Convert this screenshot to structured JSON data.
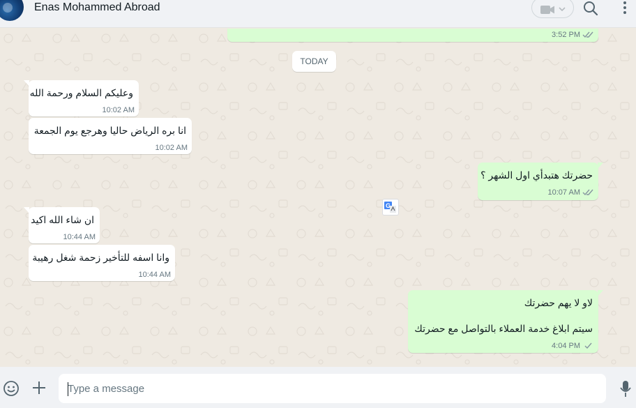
{
  "contact": {
    "name": "Enas Mohammed Abroad"
  },
  "header": {
    "icons": [
      "video-call-icon",
      "chevron-down-icon",
      "search-icon",
      "menu-icon"
    ]
  },
  "day_divider": "TODAY",
  "messages": [
    {
      "direction": "out",
      "text": "",
      "time": "3:52 PM",
      "status": "read"
    },
    {
      "direction": "in",
      "text": "وعليكم السلام ورحمة الله",
      "time": "10:02 AM"
    },
    {
      "direction": "in",
      "text": "انا بره الرياض حاليا وهرجع يوم الجمعة",
      "time": "10:02 AM"
    },
    {
      "direction": "out",
      "text": "حضرتك هتبدأي اول الشهر ؟",
      "time": "10:07 AM",
      "status": "read"
    },
    {
      "direction": "in",
      "text": "ان شاء الله اكيد",
      "time": "10:44 AM"
    },
    {
      "direction": "in",
      "text": "وانا اسفه للتأخير زحمة شغل رهيبة",
      "time": "10:44 AM"
    },
    {
      "direction": "out",
      "lines": [
        "لاو لا يهم حضرتك",
        "سيتم ابلاغ خدمة العملاء بالتواصل مع حضرتك"
      ],
      "time": "4:04 PM",
      "status": "sent"
    }
  ],
  "composer": {
    "placeholder": "Type a message"
  },
  "colors": {
    "incoming": "#ffffff",
    "outgoing": "#d9fdd3",
    "background": "#efeae2",
    "header": "#f0f2f5",
    "ticks": "#8696a0"
  }
}
